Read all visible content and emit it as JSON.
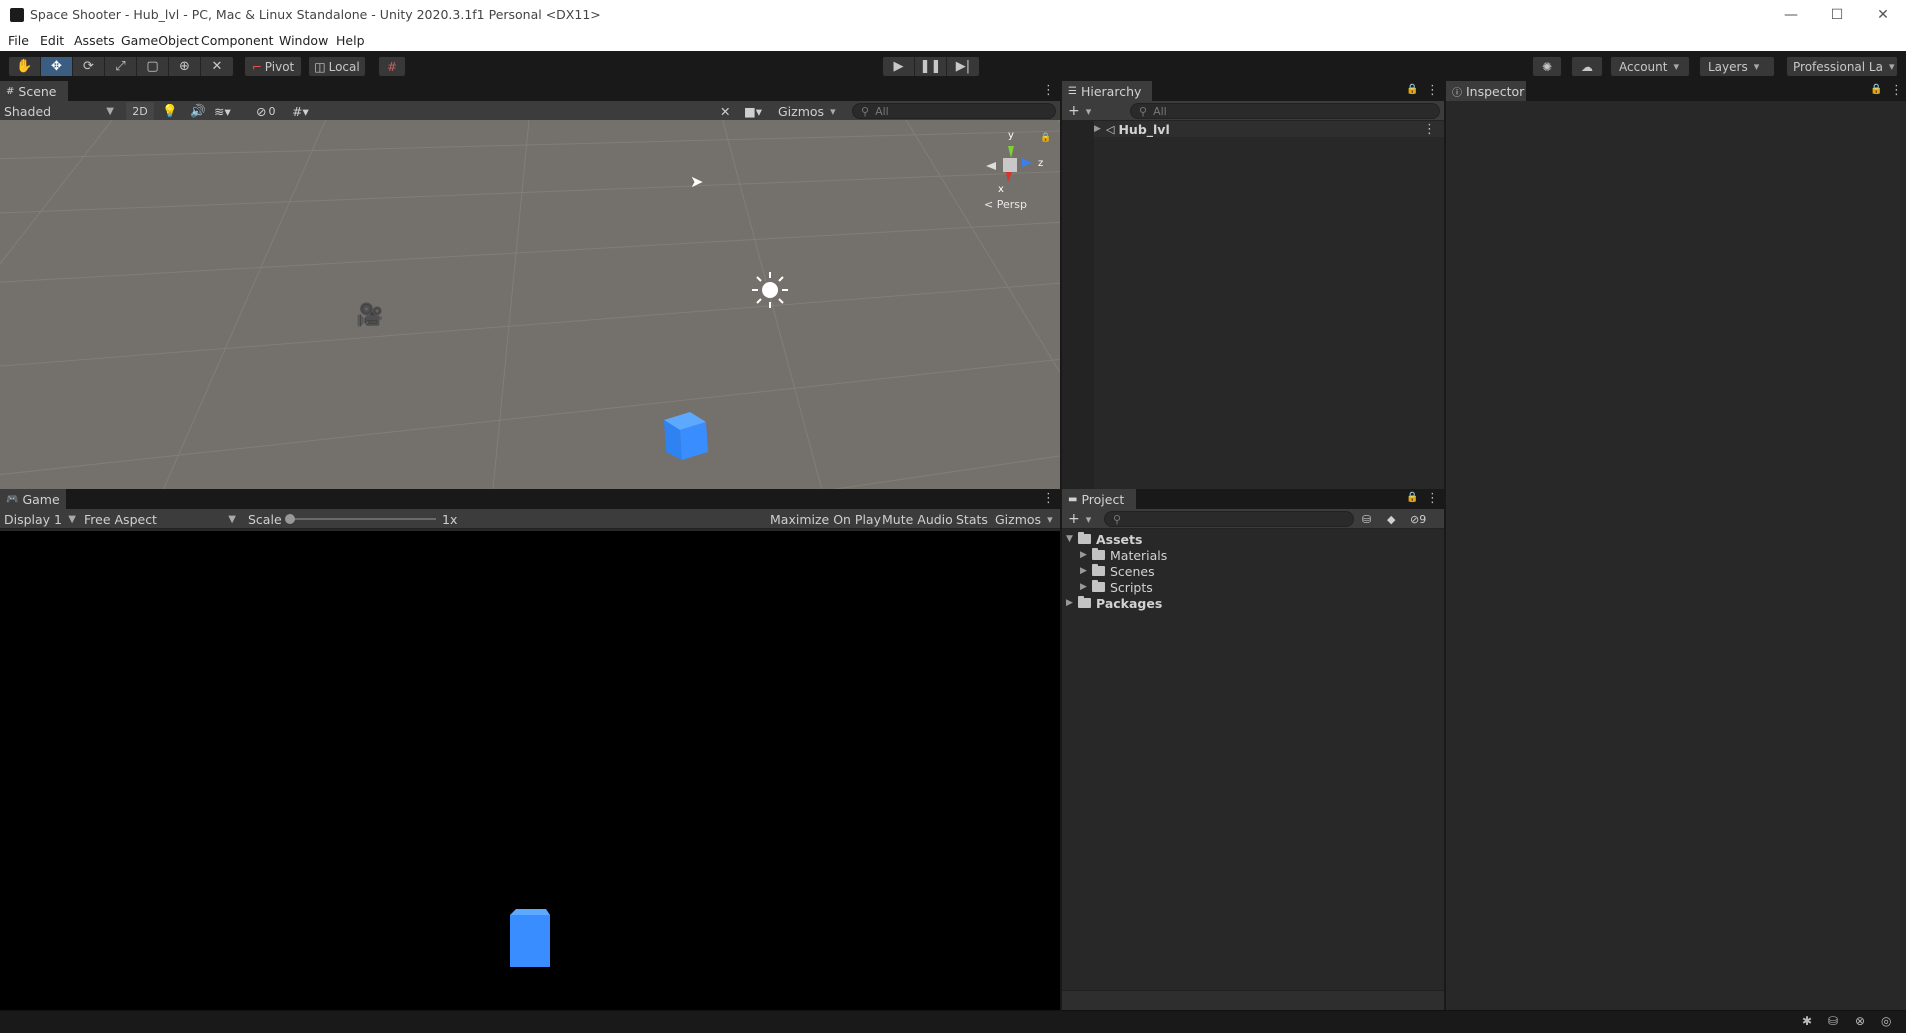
{
  "window": {
    "title": "Space Shooter - Hub_lvl - PC, Mac & Linux Standalone - Unity 2020.3.1f1 Personal <DX11>",
    "minimize": "—",
    "maximize": "☐",
    "close": "✕"
  },
  "menu": [
    "File",
    "Edit",
    "Assets",
    "GameObject",
    "Component",
    "Window",
    "Help"
  ],
  "toolbar": {
    "pivot_label": "Pivot",
    "local_label": "Local",
    "account_label": "Account",
    "layers_label": "Layers",
    "layout_label": "Professional La"
  },
  "scene": {
    "tab": "Scene",
    "shading": "Shaded",
    "mode_2d": "2D",
    "hidden_count": "0",
    "gizmos": "Gizmos",
    "search_placeholder": "All",
    "persp_label": "< Persp",
    "axis_x": "x",
    "axis_y": "y",
    "axis_z": "z"
  },
  "game": {
    "tab": "Game",
    "display": "Display 1",
    "aspect": "Free Aspect",
    "scale_label": "Scale",
    "scale_value": 1,
    "scale_text": "1x",
    "maximize_on_play": "Maximize On Play",
    "mute_audio": "Mute Audio",
    "stats": "Stats",
    "gizmos": "Gizmos"
  },
  "hierarchy": {
    "tab": "Hierarchy",
    "add_label": "+",
    "search_placeholder": "All",
    "items": [
      {
        "name": "Hub_lvl"
      }
    ]
  },
  "inspector": {
    "tab": "Inspector"
  },
  "project": {
    "tab": "Project",
    "add_label": "+",
    "hidden_count": "9",
    "tree": [
      {
        "name": "Assets",
        "expanded": true
      },
      {
        "name": "Materials"
      },
      {
        "name": "Scenes"
      },
      {
        "name": "Scripts"
      },
      {
        "name": "Packages",
        "expanded": false
      }
    ]
  },
  "colors": {
    "accent": "#3b5d82",
    "cube": "#3a8dff",
    "scene_bg": "#74706b"
  },
  "icons": [
    "unity-logo-icon",
    "hand-tool-icon",
    "move-tool-icon",
    "rotate-tool-icon",
    "scale-tool-icon",
    "rect-tool-icon",
    "transform-tool-icon",
    "custom-tool-icon",
    "grid-snap-icon",
    "play-icon",
    "pause-icon",
    "step-icon",
    "services-icon",
    "cloud-icon",
    "lock-icon",
    "kebab-menu-icon",
    "folder-icon",
    "camera-icon",
    "sun-light-icon",
    "scene-gizmo-icon",
    "search-icon"
  ]
}
